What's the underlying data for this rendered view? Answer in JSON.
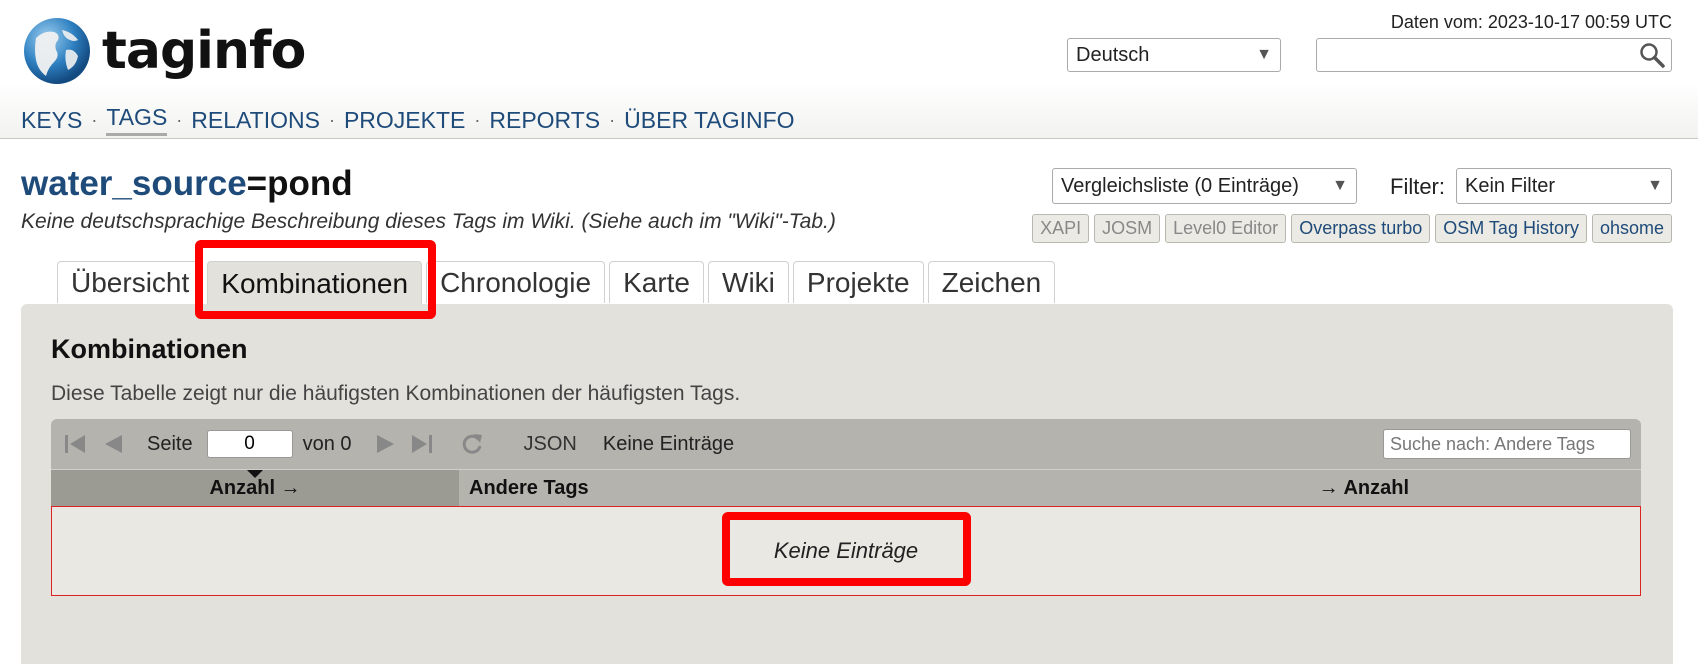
{
  "header": {
    "logo_text": "taginfo",
    "data_date": "Daten vom: 2023-10-17 00:59 UTC",
    "language": "Deutsch",
    "search_placeholder": ""
  },
  "nav": {
    "items": [
      {
        "label": "KEYS"
      },
      {
        "label": "TAGS",
        "active": true
      },
      {
        "label": "RELATIONS"
      },
      {
        "label": "PROJEKTE"
      },
      {
        "label": "REPORTS"
      },
      {
        "label": "ÜBER TAGINFO"
      }
    ]
  },
  "tag": {
    "key": "water_source",
    "eq": "=",
    "value": "pond",
    "description": "Keine deutschsprachige Beschreibung dieses Tags im Wiki. (Siehe auch im \"Wiki\"-Tab.)"
  },
  "controls": {
    "compare": "Vergleichsliste (0 Einträge)",
    "filter_label": "Filter:",
    "filter": "Kein Filter"
  },
  "external_buttons": [
    {
      "label": "XAPI",
      "enabled": false
    },
    {
      "label": "JOSM",
      "enabled": false
    },
    {
      "label": "Level0 Editor",
      "enabled": false
    },
    {
      "label": "Overpass turbo",
      "enabled": true
    },
    {
      "label": "OSM Tag History",
      "enabled": true
    },
    {
      "label": "ohsome",
      "enabled": true
    }
  ],
  "tabs": [
    {
      "label": "Übersicht"
    },
    {
      "label": "Kombinationen",
      "active": true
    },
    {
      "label": "Chronologie"
    },
    {
      "label": "Karte"
    },
    {
      "label": "Wiki"
    },
    {
      "label": "Projekte"
    },
    {
      "label": "Zeichen"
    }
  ],
  "panel": {
    "title": "Kombinationen",
    "description": "Diese Tabelle zeigt nur die häufigsten Kombinationen der häufigsten Tags.",
    "toolbar": {
      "page_label": "Seite",
      "page_value": "0",
      "of_label": "von 0",
      "json_label": "JSON",
      "entries_label": "Keine Einträge",
      "search_placeholder": "Suche nach: Andere Tags"
    },
    "table": {
      "col_count": "Anzahl →",
      "col_other": "Andere Tags",
      "col_count_right": "→ Anzahl",
      "empty": "Keine Einträge"
    }
  },
  "colors": {
    "link": "#1e4b7a",
    "panel_bg": "#e2e1db",
    "highlight": "#ff0000"
  }
}
